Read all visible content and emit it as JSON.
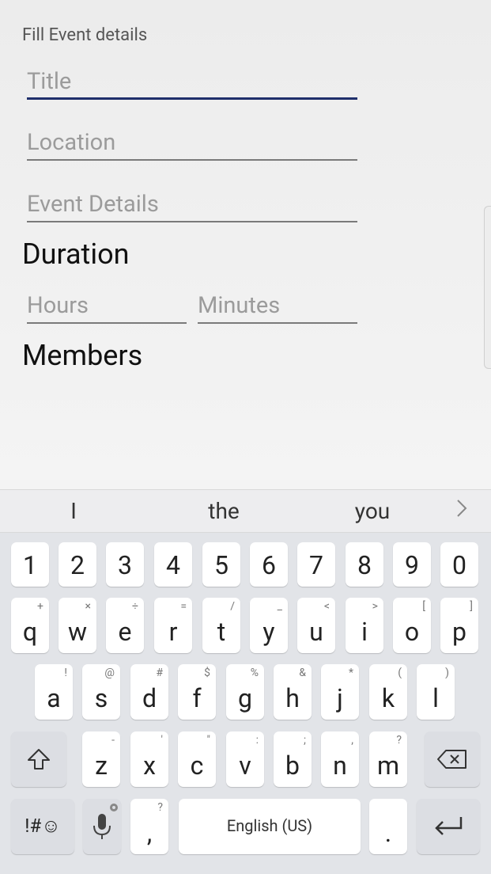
{
  "form": {
    "section_label": "Fill Event details",
    "title_placeholder": "Title",
    "location_placeholder": "Location",
    "details_placeholder": "Event Details",
    "duration_heading": "Duration",
    "hours_placeholder": "Hours",
    "minutes_placeholder": "Minutes",
    "members_heading": "Members"
  },
  "suggestions": [
    "I",
    "the",
    "you"
  ],
  "keyboard": {
    "numbers": [
      "1",
      "2",
      "3",
      "4",
      "5",
      "6",
      "7",
      "8",
      "9",
      "0"
    ],
    "row1": [
      {
        "key": "q",
        "hint": "+"
      },
      {
        "key": "w",
        "hint": "×"
      },
      {
        "key": "e",
        "hint": "÷"
      },
      {
        "key": "r",
        "hint": "="
      },
      {
        "key": "t",
        "hint": "/"
      },
      {
        "key": "y",
        "hint": "_"
      },
      {
        "key": "u",
        "hint": "<"
      },
      {
        "key": "i",
        "hint": ">"
      },
      {
        "key": "o",
        "hint": "["
      },
      {
        "key": "p",
        "hint": "]"
      }
    ],
    "row2": [
      {
        "key": "a",
        "hint": "!"
      },
      {
        "key": "s",
        "hint": "@"
      },
      {
        "key": "d",
        "hint": "#"
      },
      {
        "key": "f",
        "hint": "$"
      },
      {
        "key": "g",
        "hint": "%"
      },
      {
        "key": "h",
        "hint": "&"
      },
      {
        "key": "j",
        "hint": "*"
      },
      {
        "key": "k",
        "hint": "("
      },
      {
        "key": "l",
        "hint": ")"
      }
    ],
    "row3": [
      {
        "key": "z",
        "hint": "-"
      },
      {
        "key": "x",
        "hint": "'"
      },
      {
        "key": "c",
        "hint": "\""
      },
      {
        "key": "v",
        "hint": ":"
      },
      {
        "key": "b",
        "hint": ";"
      },
      {
        "key": "n",
        "hint": ","
      },
      {
        "key": "m",
        "hint": "?"
      }
    ],
    "symbols_label": "!#☺",
    "comma": ",",
    "comma_hint": "?",
    "space_label": "English (US)",
    "period": "."
  },
  "icons": {
    "shift": "shift-arrow-icon",
    "backspace": "backspace-icon",
    "mic": "microphone-icon",
    "enter": "enter-icon",
    "more": "chevron-right-icon"
  }
}
